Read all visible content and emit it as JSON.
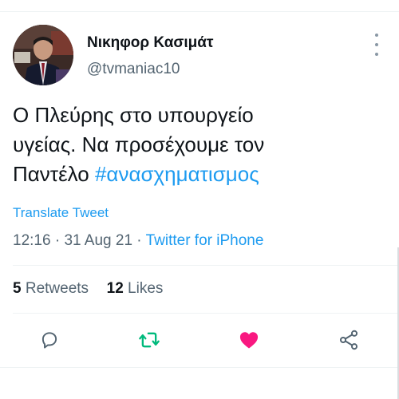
{
  "author": {
    "display_name": "Νικηφορ Κασιμάτ",
    "handle": "@tvmaniac10"
  },
  "tweet": {
    "text_lines": [
      "Ο Πλεύρης στο υπουργείο",
      "υγείας. Να προσέχουμε τον",
      "Παντέλο "
    ],
    "hashtag": "#ανασχηματισμος",
    "translate_label": "Translate Tweet",
    "time": "12:16",
    "date": "31 Aug 21",
    "separator": " · ",
    "source": "Twitter for iPhone"
  },
  "stats": {
    "retweets_count": "5",
    "retweets_label": " Retweets",
    "likes_count": "12",
    "likes_label": " Likes"
  },
  "icons": {
    "reply": "reply-icon",
    "retweet": "retweet-icon",
    "like": "heart-icon",
    "share": "share-icon",
    "more": "more-dots-icon"
  },
  "colors": {
    "link": "#1d9bf0",
    "retweet": "#00ba7c",
    "like": "#f91880",
    "text": "#0f1419",
    "muted": "#536471"
  }
}
